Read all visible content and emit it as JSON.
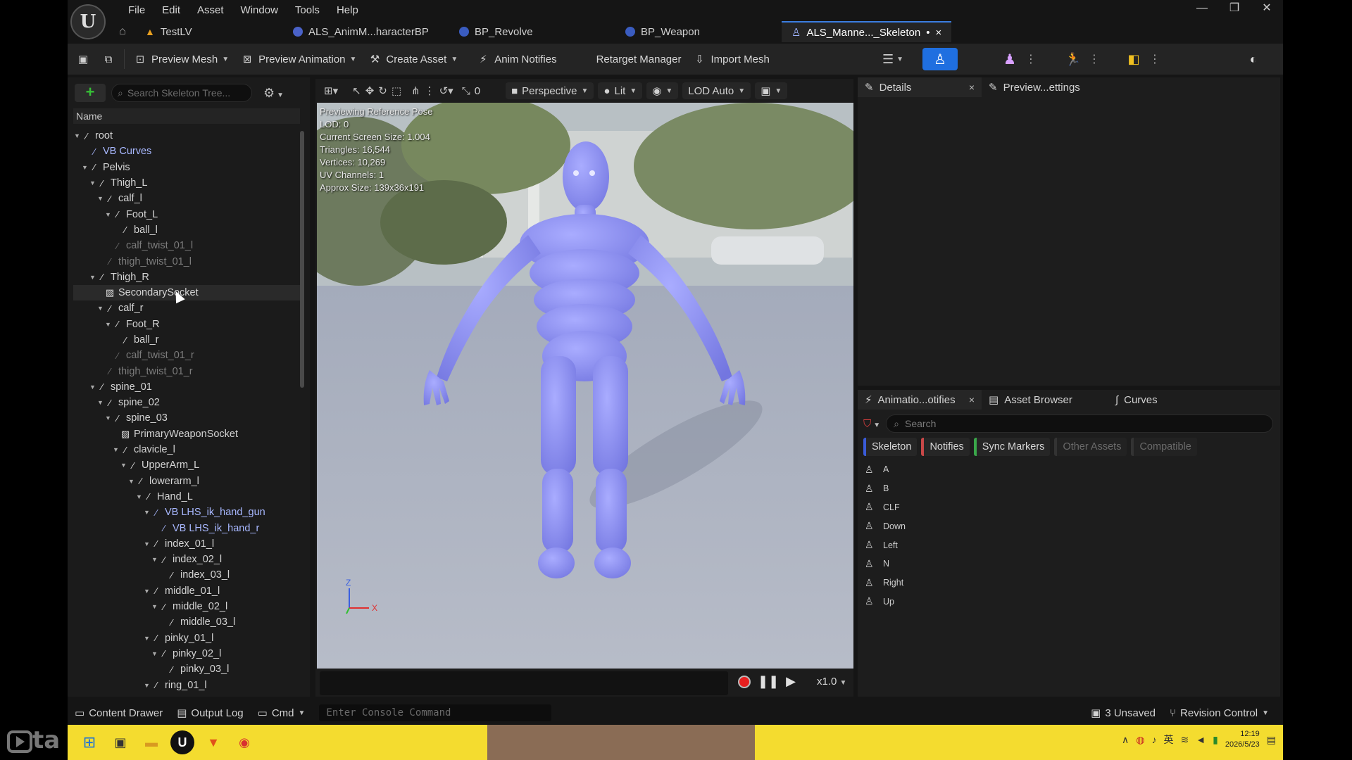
{
  "menu": [
    "File",
    "Edit",
    "Asset",
    "Window",
    "Tools",
    "Help"
  ],
  "window_controls": [
    "—",
    "❐",
    "✕"
  ],
  "doc_tabs": {
    "project": "TestLV",
    "tab1": "ALS_AnimM...haracterBP",
    "tab2": "BP_Revolve",
    "tab3": "BP_Weapon",
    "active": "ALS_Manne..._Skeleton",
    "active_flags": "•",
    "active_close": "×"
  },
  "toolbar": {
    "preview_mesh": "Preview Mesh",
    "preview_animation": "Preview Animation",
    "create_asset": "Create Asset",
    "anim_notifies": "Anim Notifies",
    "retarget_manager": "Retarget Manager",
    "import_mesh": "Import Mesh"
  },
  "skeleton_tree": {
    "search_placeholder": "Search Skeleton Tree...",
    "column_name": "Name",
    "nodes": [
      {
        "label": "root",
        "depth": 0,
        "kind": "bone",
        "arrow": true
      },
      {
        "label": "VB Curves",
        "depth": 1,
        "kind": "vb",
        "arrow": false
      },
      {
        "label": "Pelvis",
        "depth": 1,
        "kind": "bone",
        "arrow": true
      },
      {
        "label": "Thigh_L",
        "depth": 2,
        "kind": "bone",
        "arrow": true
      },
      {
        "label": "calf_l",
        "depth": 3,
        "kind": "bone",
        "arrow": true
      },
      {
        "label": "Foot_L",
        "depth": 4,
        "kind": "bone",
        "arrow": true
      },
      {
        "label": "ball_l",
        "depth": 5,
        "kind": "bone",
        "arrow": false
      },
      {
        "label": "calf_twist_01_l",
        "depth": 4,
        "kind": "dim",
        "arrow": false
      },
      {
        "label": "thigh_twist_01_l",
        "depth": 3,
        "kind": "dim",
        "arrow": false
      },
      {
        "label": "Thigh_R",
        "depth": 2,
        "kind": "bone",
        "arrow": true
      },
      {
        "label": "SecondarySocket",
        "depth": 3,
        "kind": "socket",
        "arrow": false
      },
      {
        "label": "calf_r",
        "depth": 3,
        "kind": "bone",
        "arrow": true
      },
      {
        "label": "Foot_R",
        "depth": 4,
        "kind": "bone",
        "arrow": true
      },
      {
        "label": "ball_r",
        "depth": 5,
        "kind": "bone",
        "arrow": false
      },
      {
        "label": "calf_twist_01_r",
        "depth": 4,
        "kind": "dim",
        "arrow": false
      },
      {
        "label": "thigh_twist_01_r",
        "depth": 3,
        "kind": "dim",
        "arrow": false
      },
      {
        "label": "spine_01",
        "depth": 2,
        "kind": "bone",
        "arrow": true
      },
      {
        "label": "spine_02",
        "depth": 3,
        "kind": "bone",
        "arrow": true
      },
      {
        "label": "spine_03",
        "depth": 4,
        "kind": "bone",
        "arrow": true
      },
      {
        "label": "PrimaryWeaponSocket",
        "depth": 5,
        "kind": "socket",
        "arrow": false
      },
      {
        "label": "clavicle_l",
        "depth": 5,
        "kind": "bone",
        "arrow": true
      },
      {
        "label": "UpperArm_L",
        "depth": 6,
        "kind": "bone",
        "arrow": true
      },
      {
        "label": "lowerarm_l",
        "depth": 7,
        "kind": "bone",
        "arrow": true
      },
      {
        "label": "Hand_L",
        "depth": 8,
        "kind": "bone",
        "arrow": true
      },
      {
        "label": "VB LHS_ik_hand_gun",
        "depth": 9,
        "kind": "vb",
        "arrow": true
      },
      {
        "label": "VB LHS_ik_hand_r",
        "depth": 10,
        "kind": "vb",
        "arrow": false
      },
      {
        "label": "index_01_l",
        "depth": 9,
        "kind": "bone",
        "arrow": true
      },
      {
        "label": "index_02_l",
        "depth": 10,
        "kind": "bone",
        "arrow": true
      },
      {
        "label": "index_03_l",
        "depth": 11,
        "kind": "bone",
        "arrow": false
      },
      {
        "label": "middle_01_l",
        "depth": 9,
        "kind": "bone",
        "arrow": true
      },
      {
        "label": "middle_02_l",
        "depth": 10,
        "kind": "bone",
        "arrow": true
      },
      {
        "label": "middle_03_l",
        "depth": 11,
        "kind": "bone",
        "arrow": false
      },
      {
        "label": "pinky_01_l",
        "depth": 9,
        "kind": "bone",
        "arrow": true
      },
      {
        "label": "pinky_02_l",
        "depth": 10,
        "kind": "bone",
        "arrow": true
      },
      {
        "label": "pinky_03_l",
        "depth": 11,
        "kind": "bone",
        "arrow": false
      },
      {
        "label": "ring_01_l",
        "depth": 9,
        "kind": "bone",
        "arrow": true
      }
    ]
  },
  "viewport": {
    "perspective": "Perspective",
    "lit": "Lit",
    "lod": "LOD Auto",
    "snap_value": "0",
    "overlay": [
      "Previewing Reference Pose",
      "LOD: 0",
      "Current Screen Size: 1.004",
      "Triangles: 16,544",
      "Vertices: 10,269",
      "UV Channels: 1",
      "Approx Size: 139x36x191"
    ],
    "axis_z": "Z",
    "axis_x": "X",
    "speed": "x1.0"
  },
  "details_tabs": {
    "details": "Details",
    "preview_settings": "Preview...ettings"
  },
  "notifies_panel": {
    "tab_notifies": "Animatio...otifies",
    "tab_asset_browser": "Asset Browser",
    "tab_curves": "Curves",
    "search_placeholder": "Search",
    "filters": [
      "Skeleton",
      "Notifies",
      "Sync Markers",
      "Other Assets",
      "Compatible"
    ],
    "items": [
      "A",
      "B",
      "CLF",
      "Down",
      "Left",
      "N",
      "Right",
      "Up"
    ]
  },
  "statusbar": {
    "content_drawer": "Content Drawer",
    "output_log": "Output Log",
    "cmd": "Cmd",
    "console_placeholder": "Enter Console Command",
    "unsaved": "3 Unsaved",
    "revision_control": "Revision Control"
  },
  "taskbar": {
    "time": "12:19",
    "date": "2026/5/23",
    "ime": "英"
  },
  "colors": {
    "accent_blue": "#1f6fe0",
    "mannequin": "#8b8df0",
    "chip_skeleton": "#3a5bd8",
    "chip_notifies": "#c84848",
    "chip_sync": "#3aa84a",
    "taskbar": "#f4dc2f"
  }
}
